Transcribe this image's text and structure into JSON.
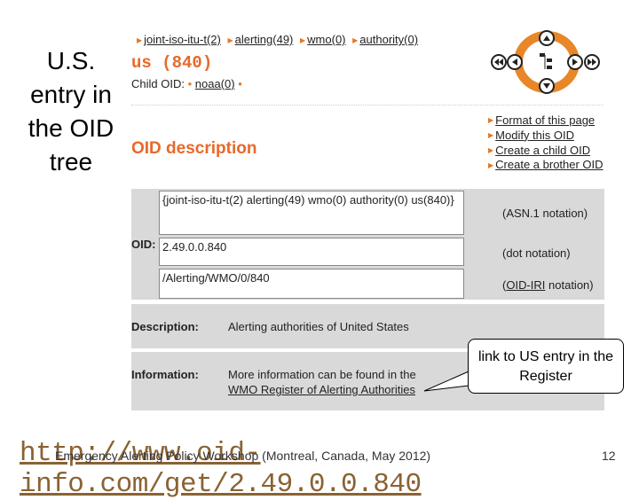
{
  "slide": {
    "side_title": "U.S. entry in the OID tree",
    "callout": "link to US entry in the Register",
    "url": "http://www.oid-info.com/get/2.49.0.0.840",
    "footer": "Emergency Alerting Policy Workshop (Montreal, Canada, May 2012)",
    "page": "12"
  },
  "breadcrumb": [
    "joint-iso-itu-t(2)",
    "alerting(49)",
    "wmo(0)",
    "authority(0)"
  ],
  "oid_title": "us (840)",
  "child": {
    "label": "Child OID:",
    "items": [
      "noaa(0)"
    ]
  },
  "links": [
    "Format of this page",
    "Modify this OID",
    "Create a child OID",
    "Create a brother OID"
  ],
  "description_heading": "OID description",
  "oid": {
    "label": "OID:",
    "asn1": "{joint-iso-itu-t(2) alerting(49) wmo(0) authority(0) us(840)}",
    "asn1_note": "(ASN.1 notation)",
    "dot": "2.49.0.0.840",
    "dot_note": "(dot notation)",
    "iri": "/Alerting/WMO/0/840",
    "iri_note_link": "OID-IRI",
    "iri_note": " notation)"
  },
  "description": {
    "label": "Description:",
    "value": "Alerting authorities of United States"
  },
  "information": {
    "label": "Information:",
    "text": "More information can be found in the",
    "link": "WMO Register of Alerting Authorities"
  },
  "colors": {
    "accent": "#e8692a",
    "url": "#8a6233",
    "band": "#d9d9d9"
  }
}
